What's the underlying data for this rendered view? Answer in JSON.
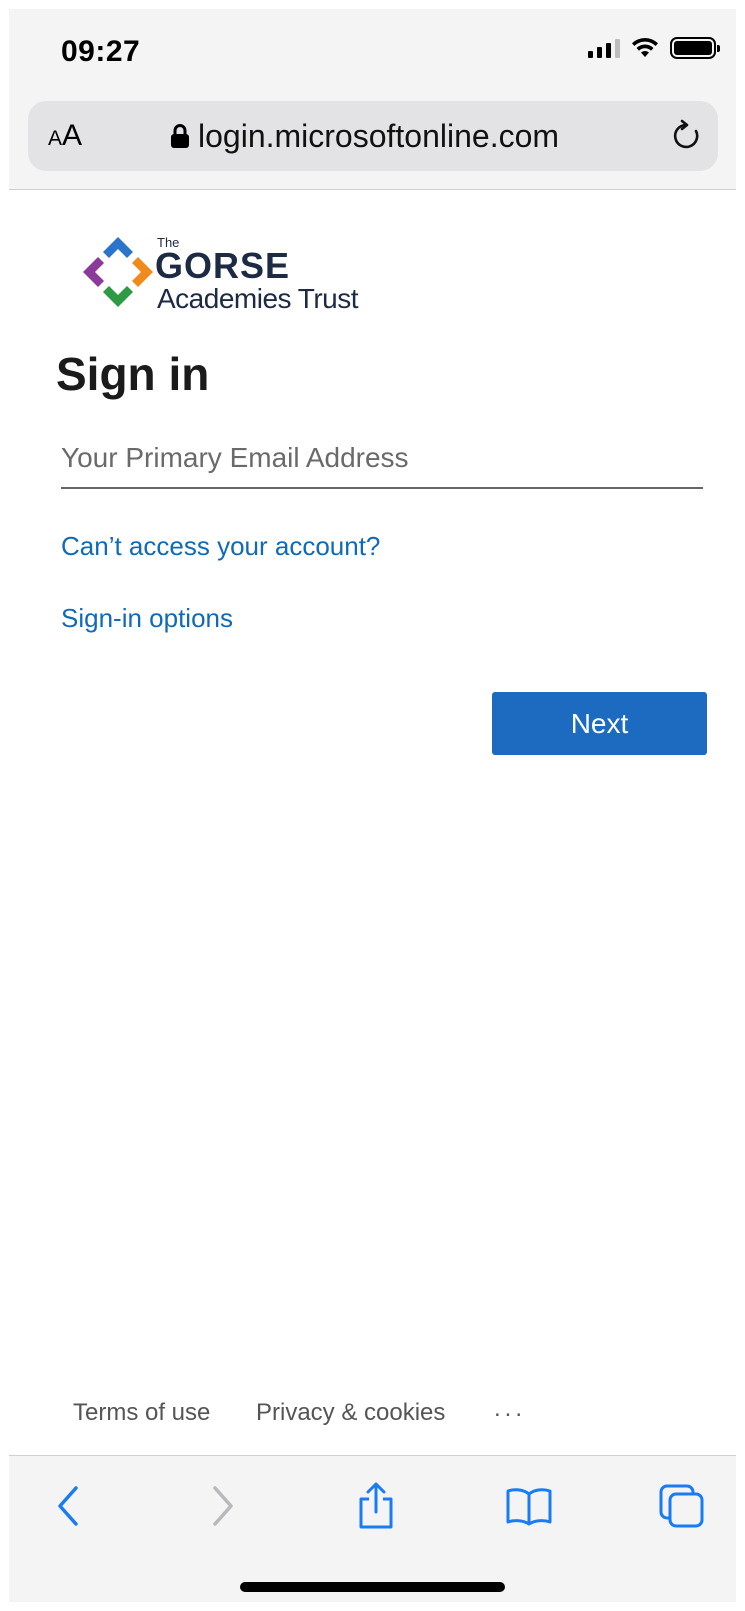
{
  "status_bar": {
    "time": "09:27"
  },
  "browser": {
    "text_size_button": {
      "small": "A",
      "large": "A"
    },
    "url": "login.microsoftonline.com"
  },
  "logo": {
    "the": "The",
    "name": "GORSE",
    "subtitle": "Academies Trust"
  },
  "signin": {
    "title": "Sign in",
    "email_placeholder": "Your Primary Email Address",
    "email_value": "",
    "cant_access_link": "Can’t access your account?",
    "options_link": "Sign-in options",
    "next_button": "Next"
  },
  "footer": {
    "terms": "Terms of use",
    "privacy": "Privacy & cookies",
    "more": "..."
  },
  "toolbar": {
    "icons": [
      "back-icon",
      "forward-icon",
      "share-icon",
      "bookmarks-icon",
      "tabs-icon"
    ]
  },
  "colors": {
    "accent": "#1c6bc1",
    "link": "#0f6ab8",
    "ios_blue": "#1a7cf2"
  }
}
